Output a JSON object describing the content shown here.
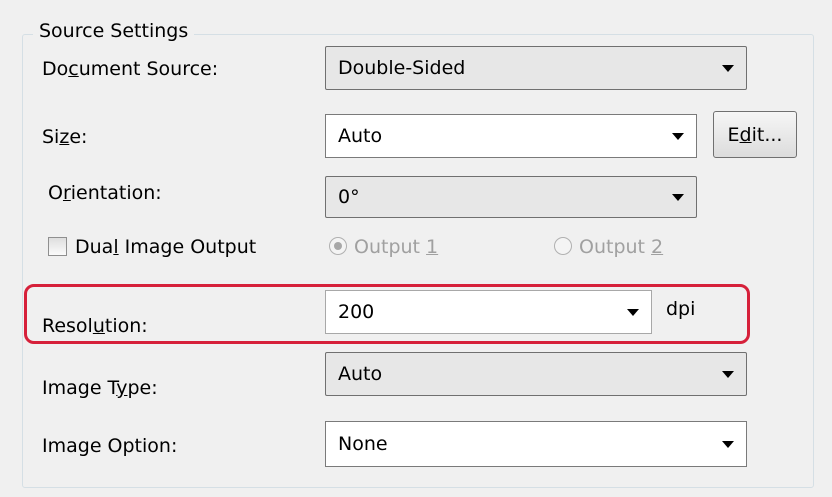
{
  "group_title": "Source Settings",
  "document_source": {
    "label_before": "Do",
    "label_u": "c",
    "label_after": "ument Source:",
    "value": "Double-Sided"
  },
  "size": {
    "label_before": "Si",
    "label_u": "z",
    "label_after": "e:",
    "value": "Auto",
    "edit_before": "E",
    "edit_u": "d",
    "edit_after": "it..."
  },
  "orientation": {
    "label_before": "O",
    "label_u": "r",
    "label_after": "ientation:",
    "value": "0°"
  },
  "dual_output": {
    "checkbox_before": "Dua",
    "checkbox_u": "l",
    "checkbox_after": " Image Output",
    "output1_before": "Output ",
    "output1_u": "1",
    "output2_before": "Output ",
    "output2_u": "2"
  },
  "resolution": {
    "label_before": "Resol",
    "label_u": "u",
    "label_after": "tion:",
    "value": "200",
    "unit": "dpi"
  },
  "image_type": {
    "label_before": "Image T",
    "label_u": "y",
    "label_after": "pe:",
    "value": "Auto"
  },
  "image_option": {
    "label": "Image Option:",
    "value": "None"
  },
  "colors": {
    "highlight": "#d6203a",
    "frame": "#d5dfe5",
    "background": "#f0f0f0"
  }
}
